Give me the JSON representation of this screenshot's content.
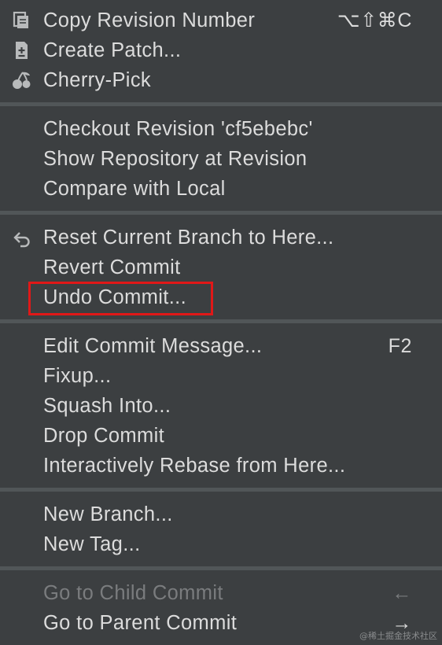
{
  "menu": {
    "group1": {
      "copy_revision": {
        "label": "Copy Revision Number",
        "shortcut": "⌥⇧⌘C",
        "icon": "copy-icon"
      },
      "create_patch": {
        "label": "Create Patch...",
        "icon": "patch-icon"
      },
      "cherry_pick": {
        "label": "Cherry-Pick",
        "icon": "cherry-icon"
      }
    },
    "group2": {
      "checkout_revision": {
        "label": "Checkout Revision 'cf5ebebc'"
      },
      "show_repository": {
        "label": "Show Repository at Revision"
      },
      "compare_local": {
        "label": "Compare with Local"
      }
    },
    "group3": {
      "reset_branch": {
        "label": "Reset Current Branch to Here...",
        "icon": "undo-arrow-icon"
      },
      "revert_commit": {
        "label": "Revert Commit"
      },
      "undo_commit": {
        "label": "Undo Commit...",
        "highlighted": true
      }
    },
    "group4": {
      "edit_message": {
        "label": "Edit Commit Message...",
        "shortcut": "F2"
      },
      "fixup": {
        "label": "Fixup..."
      },
      "squash_into": {
        "label": "Squash Into..."
      },
      "drop_commit": {
        "label": "Drop Commit"
      },
      "interactive_rebase": {
        "label": "Interactively Rebase from Here..."
      }
    },
    "group5": {
      "new_branch": {
        "label": "New Branch..."
      },
      "new_tag": {
        "label": "New Tag..."
      }
    },
    "group6": {
      "go_child": {
        "label": "Go to Child Commit",
        "shortcut": "←",
        "disabled": true
      },
      "go_parent": {
        "label": "Go to Parent Commit",
        "shortcut": "→"
      }
    }
  },
  "watermark": "@稀土掘金技术社区",
  "colors": {
    "background": "#3c3f41",
    "text": "#dcdcdc",
    "disabled_text": "#7a7c7e",
    "separator": "#515658",
    "highlight_border": "#e01818"
  }
}
